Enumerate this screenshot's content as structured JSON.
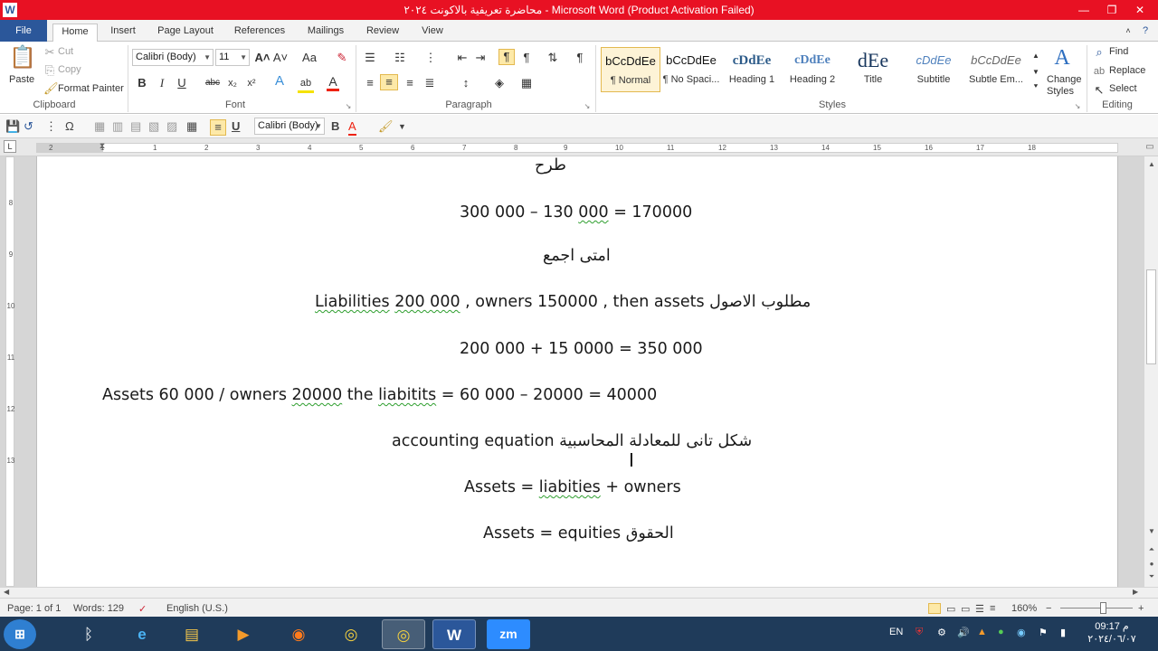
{
  "window": {
    "title": "محاضرة تعريفية بالاكونت ٢٠٢٤  -  Microsoft Word (Product Activation Failed)",
    "app_icon": "W",
    "minimize": "—",
    "maximize": "❐",
    "close": "✕"
  },
  "tabs": [
    {
      "label": "File"
    },
    {
      "label": "Home"
    },
    {
      "label": "Insert"
    },
    {
      "label": "Page Layout"
    },
    {
      "label": "References"
    },
    {
      "label": "Mailings"
    },
    {
      "label": "Review"
    },
    {
      "label": "View"
    }
  ],
  "ribbon": {
    "clipboard": {
      "paste": "Paste",
      "cut": "Cut",
      "copy": "Copy",
      "format_painter": "Format Painter",
      "label": "Clipboard"
    },
    "font": {
      "name": "Calibri (Body)",
      "size": "11",
      "label": "Font",
      "bold": "B",
      "italic": "I",
      "underline": "U",
      "strike": "abc",
      "subscript": "x₂",
      "superscript": "x²",
      "grow": "A˄",
      "shrink": "A˅",
      "change_case": "Aa",
      "clear": "✎",
      "effects": "A",
      "highlight": "ab",
      "color": "A"
    },
    "paragraph": {
      "label": "Paragraph",
      "show_marks": "¶"
    },
    "styles": {
      "label": "Styles",
      "items": [
        {
          "sample": "bCcDdEe",
          "name": "¶ Normal"
        },
        {
          "sample": "bCcDdEe",
          "name": "¶ No Spaci..."
        },
        {
          "sample": "cDdEe",
          "name": "Heading 1"
        },
        {
          "sample": "cDdEe",
          "name": "Heading 2"
        },
        {
          "sample": "dEe",
          "name": "Title"
        },
        {
          "sample": "cDdEe",
          "name": "Subtitle"
        },
        {
          "sample": "bCcDdEe",
          "name": "Subtle Em..."
        }
      ],
      "change_styles_1": "Change",
      "change_styles_2": "Styles"
    },
    "editing": {
      "label": "Editing",
      "find": "Find",
      "replace": "Replace",
      "select": "Select"
    }
  },
  "qat": {
    "font_name": "Calibri (Body)"
  },
  "ruler": {
    "numbers": [
      "2",
      "1",
      "1",
      "2",
      "3",
      "4",
      "5",
      "6",
      "7",
      "8",
      "9",
      "10",
      "11",
      "12",
      "13",
      "14",
      "15",
      "16",
      "17",
      "18"
    ],
    "vnumbers": [
      "8",
      "9",
      "10",
      "11",
      "12",
      "13"
    ]
  },
  "document": {
    "lines": {
      "l1": "طرح",
      "l2a": "300 000 – 130 ",
      "l2b": "000",
      "l2c": "  = 170000",
      "l3": "امتى اجمع",
      "l4a": "Liabilities",
      "l4b": "  ",
      "l4c": "200 000",
      "l4d": " , owners 150000  , then assets  مطلوب الاصول",
      "l5": "200 000 + 15 0000 = 350 000",
      "l6a": "Assets 60 000   / owners ",
      "l6b": "20000",
      "l6c": "  the ",
      "l6d": "liabitits",
      "l6e": " = 60 000 – 20000 = 40000",
      "l7": "accounting equation   شكل تانى للمعادلة المحاسبية",
      "l8a": "Assets = ",
      "l8b": "liabities",
      "l8c": "  + owners",
      "l9": "Assets = equities الحقوق"
    }
  },
  "status": {
    "page": "Page: 1 of 1",
    "words": "Words: 129",
    "language": "English (U.S.)",
    "zoom": "160%",
    "zoom_minus": "−",
    "zoom_plus": "+"
  },
  "taskbar": {
    "start": "⊞",
    "apps": [
      {
        "name": "bluetooth",
        "glyph": "ᛒ"
      },
      {
        "name": "internet-explorer",
        "glyph": "e"
      },
      {
        "name": "file-explorer",
        "glyph": "▤"
      },
      {
        "name": "media-player",
        "glyph": "▶"
      },
      {
        "name": "firefox",
        "glyph": "◉"
      },
      {
        "name": "chrome",
        "glyph": "◎"
      },
      {
        "name": "chrome-2",
        "glyph": "◎"
      },
      {
        "name": "word",
        "glyph": "W"
      },
      {
        "name": "zoom",
        "glyph": "zm"
      }
    ],
    "lang": "EN",
    "time": "09:17 م",
    "date": "٢٠٢٤/٠٦/٠٧"
  },
  "colors": {
    "titlebar": "#e81123",
    "file_tab": "#2b579a",
    "taskbar": "#1f3b5a",
    "spell_underline": "#2e9e2e"
  }
}
